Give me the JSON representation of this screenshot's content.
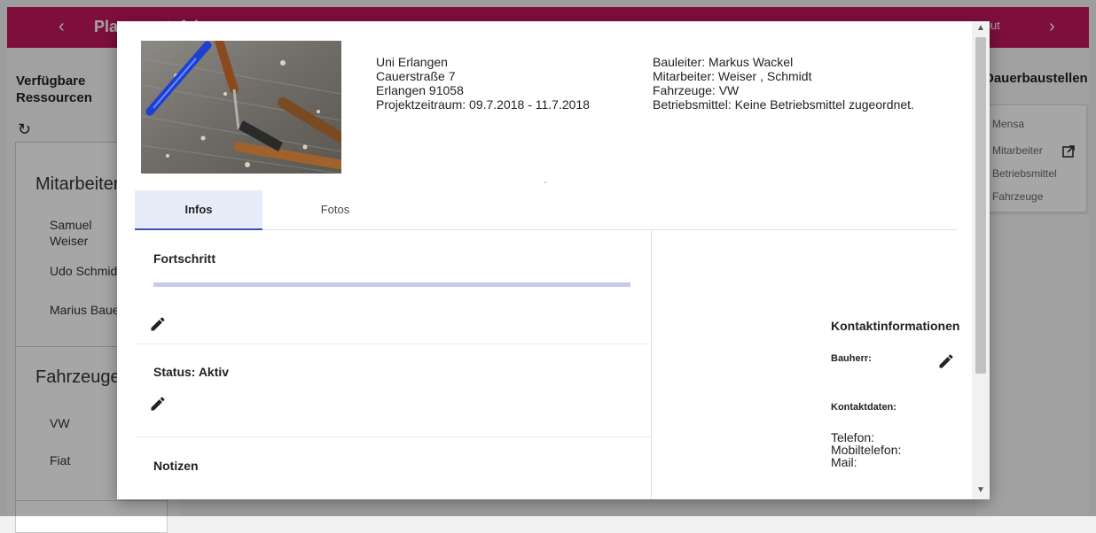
{
  "app": {
    "title": "Planungstafel",
    "back_icon": "‹",
    "forward_icon": "›",
    "logout_label": "Logout",
    "accent_color": "#c2185b"
  },
  "left_panel": {
    "title": "Verfügbare Ressourcen",
    "refresh_icon": "↻",
    "sections": [
      {
        "title": "Mitarbeiter",
        "items": [
          "Samuel Weiser",
          "Udo Schmidt",
          "Marius Bauer"
        ]
      },
      {
        "title": "Fahrzeuge",
        "items": [
          "VW",
          "Fiat"
        ]
      }
    ]
  },
  "right_panel": {
    "title": "Dauerbaustellen",
    "card": {
      "name": "Mensa",
      "links": [
        "Mitarbeiter",
        "Betriebsmittel",
        "Fahrzeuge"
      ]
    }
  },
  "modal": {
    "address": {
      "name": "Uni Erlangen",
      "street": "Cauerstraße 7",
      "city": "Erlangen 91058",
      "period": "Projektzeitraum: 09.7.2018 - 11.7.2018"
    },
    "meta": {
      "bauleiter": "Bauleiter: Markus Wackel",
      "mitarbeiter": "Mitarbeiter: Weiser , Schmidt",
      "fahrzeuge": "Fahrzeuge: VW",
      "betriebsmittel": "Betriebsmittel: Keine Betriebsmittel zugeordnet."
    },
    "tabs": [
      {
        "label": "Infos",
        "active": true
      },
      {
        "label": "Fotos",
        "active": false
      }
    ],
    "progress": {
      "label": "Fortschritt",
      "value_percent": 0
    },
    "status": {
      "label": "Status: Aktiv"
    },
    "notes": {
      "label": "Notizen"
    },
    "contact": {
      "title": "Kontaktinformationen",
      "bauherr_label": "Bauherr:",
      "kontaktdaten_label": "Kontaktdaten:",
      "telefon": "Telefon:",
      "mobiltelefon": "Mobiltelefon:",
      "mail": "Mail:"
    },
    "scroll": {
      "up_icon": "▲",
      "down_icon": "▼"
    }
  }
}
